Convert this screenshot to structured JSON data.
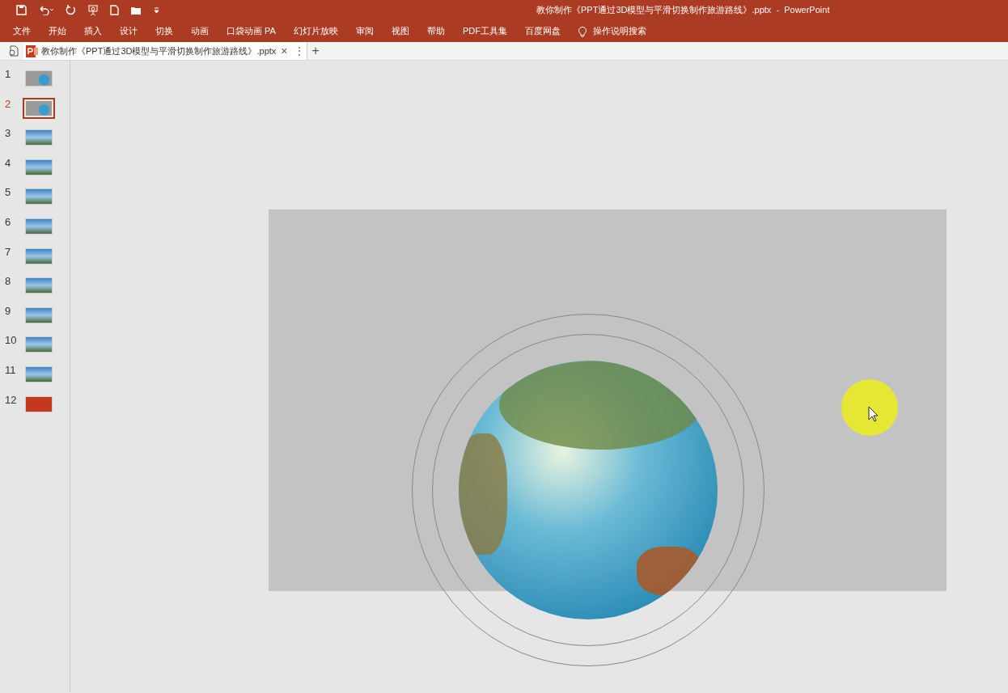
{
  "window": {
    "title": "教你制作《PPT通过3D模型与平滑切换制作旅游路线》.pptx  -  PowerPoint"
  },
  "ribbon_tabs": [
    "文件",
    "开始",
    "插入",
    "设计",
    "切换",
    "动画",
    "口袋动画 PA",
    "幻灯片放映",
    "审阅",
    "视图",
    "帮助",
    "PDF工具集",
    "百度网盘"
  ],
  "tell_me": "操作说明搜索",
  "document_tab": {
    "title": "教你制作《PPT通过3D模型与平滑切换制作旅游路线》.pptx",
    "close": "×",
    "more": "⋮",
    "new_tab": "+"
  },
  "slides": [
    {
      "number": "1",
      "selected": false,
      "kind": "globe"
    },
    {
      "number": "2",
      "selected": true,
      "kind": "globe"
    },
    {
      "number": "3",
      "selected": false,
      "kind": "photo"
    },
    {
      "number": "4",
      "selected": false,
      "kind": "photo"
    },
    {
      "number": "5",
      "selected": false,
      "kind": "photo"
    },
    {
      "number": "6",
      "selected": false,
      "kind": "photo"
    },
    {
      "number": "7",
      "selected": false,
      "kind": "photo"
    },
    {
      "number": "8",
      "selected": false,
      "kind": "photo"
    },
    {
      "number": "9",
      "selected": false,
      "kind": "photo"
    },
    {
      "number": "10",
      "selected": false,
      "kind": "photo"
    },
    {
      "number": "11",
      "selected": false,
      "kind": "photo"
    },
    {
      "number": "12",
      "selected": false,
      "kind": "title"
    }
  ]
}
